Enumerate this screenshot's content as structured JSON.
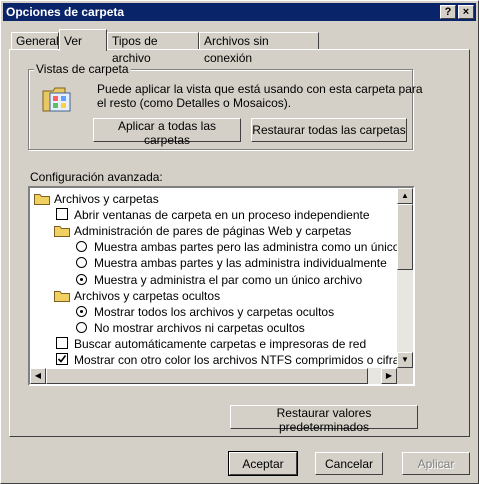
{
  "window": {
    "title": "Opciones de carpeta",
    "help_label": "?",
    "close_label": "×"
  },
  "tabs": [
    {
      "label": "General"
    },
    {
      "label": "Ver",
      "active": true
    },
    {
      "label": "Tipos de archivo"
    },
    {
      "label": "Archivos sin conexión"
    }
  ],
  "views": {
    "title": "Vistas de carpeta",
    "description_line1": "Puede aplicar la vista que está usando con esta carpeta para",
    "description_line2": "el resto (como Detalles o Mosaicos).",
    "apply_all_label": "Aplicar a todas las carpetas",
    "reset_all_label": "Restaurar todas las carpetas"
  },
  "advanced": {
    "label": "Configuración avanzada:",
    "items": [
      {
        "type": "folder",
        "text": "Archivos y carpetas",
        "indent": 0
      },
      {
        "type": "checkbox",
        "checked": false,
        "text": "Abrir ventanas de carpeta  en un proceso independiente",
        "indent": 1
      },
      {
        "type": "folder",
        "text": "Administración de pares de páginas Web y carpetas",
        "indent": 1
      },
      {
        "type": "radio",
        "checked": false,
        "text": "Muestra ambas partes pero las administra como un único archivo",
        "indent": 2
      },
      {
        "type": "radio",
        "checked": false,
        "text": "Muestra ambas partes y las administra individualmente",
        "indent": 2
      },
      {
        "type": "radio",
        "checked": true,
        "text": "Muestra y administra el par como un único archivo",
        "indent": 2
      },
      {
        "type": "folder",
        "text": "Archivos y carpetas ocultos",
        "indent": 1
      },
      {
        "type": "radio",
        "checked": true,
        "text": "Mostrar todos los archivos y carpetas ocultos",
        "indent": 2
      },
      {
        "type": "radio",
        "checked": false,
        "text": "No mostrar archivos ni carpetas ocultos",
        "indent": 2
      },
      {
        "type": "checkbox",
        "checked": false,
        "text": "Buscar automáticamente carpetas e impresoras de red",
        "indent": 1
      },
      {
        "type": "checkbox",
        "checked": true,
        "text": "Mostrar con otro color los archivos NTFS comprimidos o cifrados",
        "indent": 1
      }
    ],
    "restore_defaults_label": "Restaurar valores predeterminados"
  },
  "footer": {
    "accept_label": "Aceptar",
    "cancel_label": "Cancelar",
    "apply_label": "Aplicar"
  },
  "colors": {
    "title_bar": "#0a246a",
    "face": "#d4d0c8",
    "folder": "#f0d060"
  }
}
